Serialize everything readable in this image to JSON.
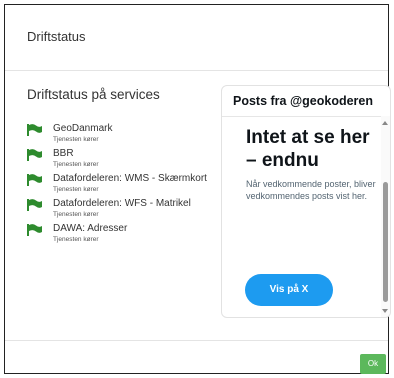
{
  "dialog": {
    "title": "Driftstatus"
  },
  "services": {
    "heading": "Driftstatus på services",
    "items": [
      {
        "name": "GeoDanmark",
        "status": "Tjenesten kører"
      },
      {
        "name": "BBR",
        "status": "Tjenesten kører"
      },
      {
        "name": "Datafordeleren: WMS - Skærmkort",
        "status": "Tjenesten kører"
      },
      {
        "name": "Datafordeleren: WFS - Matrikel",
        "status": "Tjenesten kører"
      },
      {
        "name": "DAWA: Adresser",
        "status": "Tjenesten kører"
      }
    ],
    "status_icon": "flag-icon",
    "status_color": "#2e8b2e"
  },
  "twitter": {
    "header": "Posts fra @geokoderen",
    "empty_title": "Intet at se her – endnu",
    "empty_desc": "Når vedkommende poster, bliver vedkommendes posts vist her.",
    "view_button": "Vis på X",
    "button_color": "#1d9bf0"
  },
  "footer": {
    "ok_label": "Ok",
    "ok_color": "#5cb85c"
  }
}
